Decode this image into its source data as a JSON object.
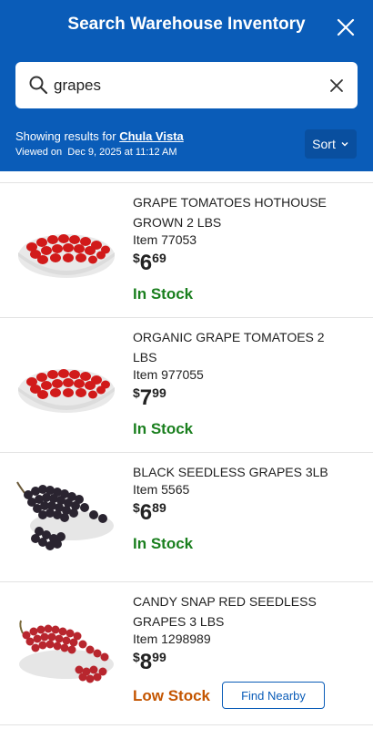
{
  "header": {
    "title": "Search Warehouse Inventory",
    "results_prefix": "Showing results for",
    "location": "Chula Vista",
    "viewed_prefix": "Viewed on",
    "viewed_date": "Dec 9, 2025 at 11:12 AM",
    "sort_label": "Sort"
  },
  "search": {
    "value": "grapes",
    "placeholder": ""
  },
  "colors": {
    "brand": "#0a5cb8",
    "in_stock": "#1a7f1e",
    "low_stock": "#c45500"
  },
  "products": [
    {
      "name": "GRAPE TOMATOES HOTHOUSE GROWN 2 LBS",
      "item": "Item 77053",
      "currency": "$",
      "dollars": "6",
      "cents": "69",
      "stock": "In Stock",
      "image": "red-tomatoes-bowl"
    },
    {
      "name": "ORGANIC GRAPE TOMATOES 2 LBS",
      "item": "Item 977055",
      "currency": "$",
      "dollars": "7",
      "cents": "99",
      "stock": "In Stock",
      "image": "red-tomatoes-bowl"
    },
    {
      "name": "BLACK SEEDLESS GRAPES 3LB",
      "item": "Item 5565",
      "currency": "$",
      "dollars": "6",
      "cents": "89",
      "stock": "In Stock",
      "image": "black-grapes-bowl"
    },
    {
      "name": "CANDY SNAP RED SEEDLESS GRAPES 3 LBS",
      "item": "Item 1298989",
      "currency": "$",
      "dollars": "8",
      "cents": "99",
      "stock": "Low Stock",
      "action": "Find Nearby",
      "image": "red-grapes-bowl"
    }
  ]
}
